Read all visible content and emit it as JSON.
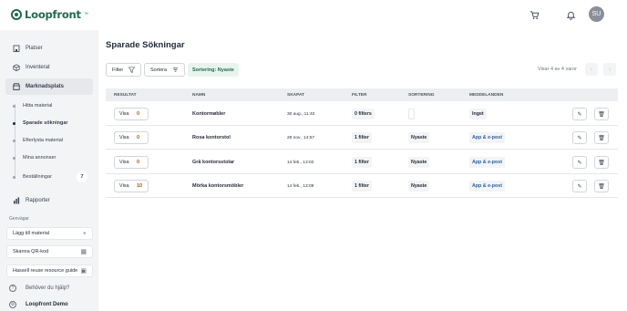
{
  "header": {
    "logo": "Loopfront",
    "logo_tm": "™",
    "avatar_initials": "SU",
    "icons": [
      "cart-icon",
      "bell-icon"
    ]
  },
  "sidebar": {
    "items": [
      {
        "label": "Platser",
        "icon": "building-icon"
      },
      {
        "label": "Inventerat",
        "icon": "box-icon"
      },
      {
        "label": "Marknadsplats",
        "icon": "store-icon"
      }
    ],
    "subitems": [
      {
        "label": "Hitta material"
      },
      {
        "label": "Sparade sökningar"
      },
      {
        "label": "Efterlysta material"
      },
      {
        "label": "Mina annonser"
      },
      {
        "label": "Beställningar",
        "badge": "7"
      }
    ],
    "reports_label": "Rapporter",
    "shortcuts_title": "Genvägar",
    "shortcuts": [
      {
        "label": "Lägg till material",
        "icon": "plus-icon"
      },
      {
        "label": "Skanna QR-kod",
        "icon": "qr-icon"
      },
      {
        "label": "Hassell reuse resource guide",
        "icon": "book-icon"
      }
    ],
    "help_label": "Behöver du hjälp?",
    "org_label": "Loopfront Demo"
  },
  "main": {
    "title": "Sparade Sökningar",
    "filter_label": "Filter",
    "sort_label": "Sortera",
    "sort_info": "Sortering: Nyaste",
    "count_text": "Visar 4 av 4 varor",
    "columns": [
      "RESULTAT",
      "NAMN",
      "SKAPAT",
      "FILTER",
      "SORTERING",
      "MEDDELANDEN"
    ],
    "rows": [
      {
        "visa": "Visa",
        "result": "0",
        "name": "Kontormøbler",
        "created": "30 aug., 11:40",
        "filter": "0 filters",
        "sort": "",
        "notify": "Inget"
      },
      {
        "visa": "Visa",
        "result": "0",
        "name": "Rosa kontorstol",
        "created": "28 nov., 14:57",
        "filter": "1 filter",
        "sort": "Nyaste",
        "notify": "App & e-post"
      },
      {
        "visa": "Visa",
        "result": "0",
        "name": "Grå kontorsstolar",
        "created": "14 feb., 13:02",
        "filter": "1 filter",
        "sort": "Nyaste",
        "notify": "App & e-post"
      },
      {
        "visa": "Visa",
        "result": "10",
        "name": "Mörka kontorsmöbler",
        "created": "14 feb., 13:09",
        "filter": "1 filter",
        "sort": "Nyaste",
        "notify": "App & e-post"
      }
    ]
  },
  "colors": {
    "brand": "#1f6b4e",
    "accent_orange": "#b45309",
    "link_blue": "#2563a8",
    "sidebar_bg": "#f3f4f6"
  }
}
